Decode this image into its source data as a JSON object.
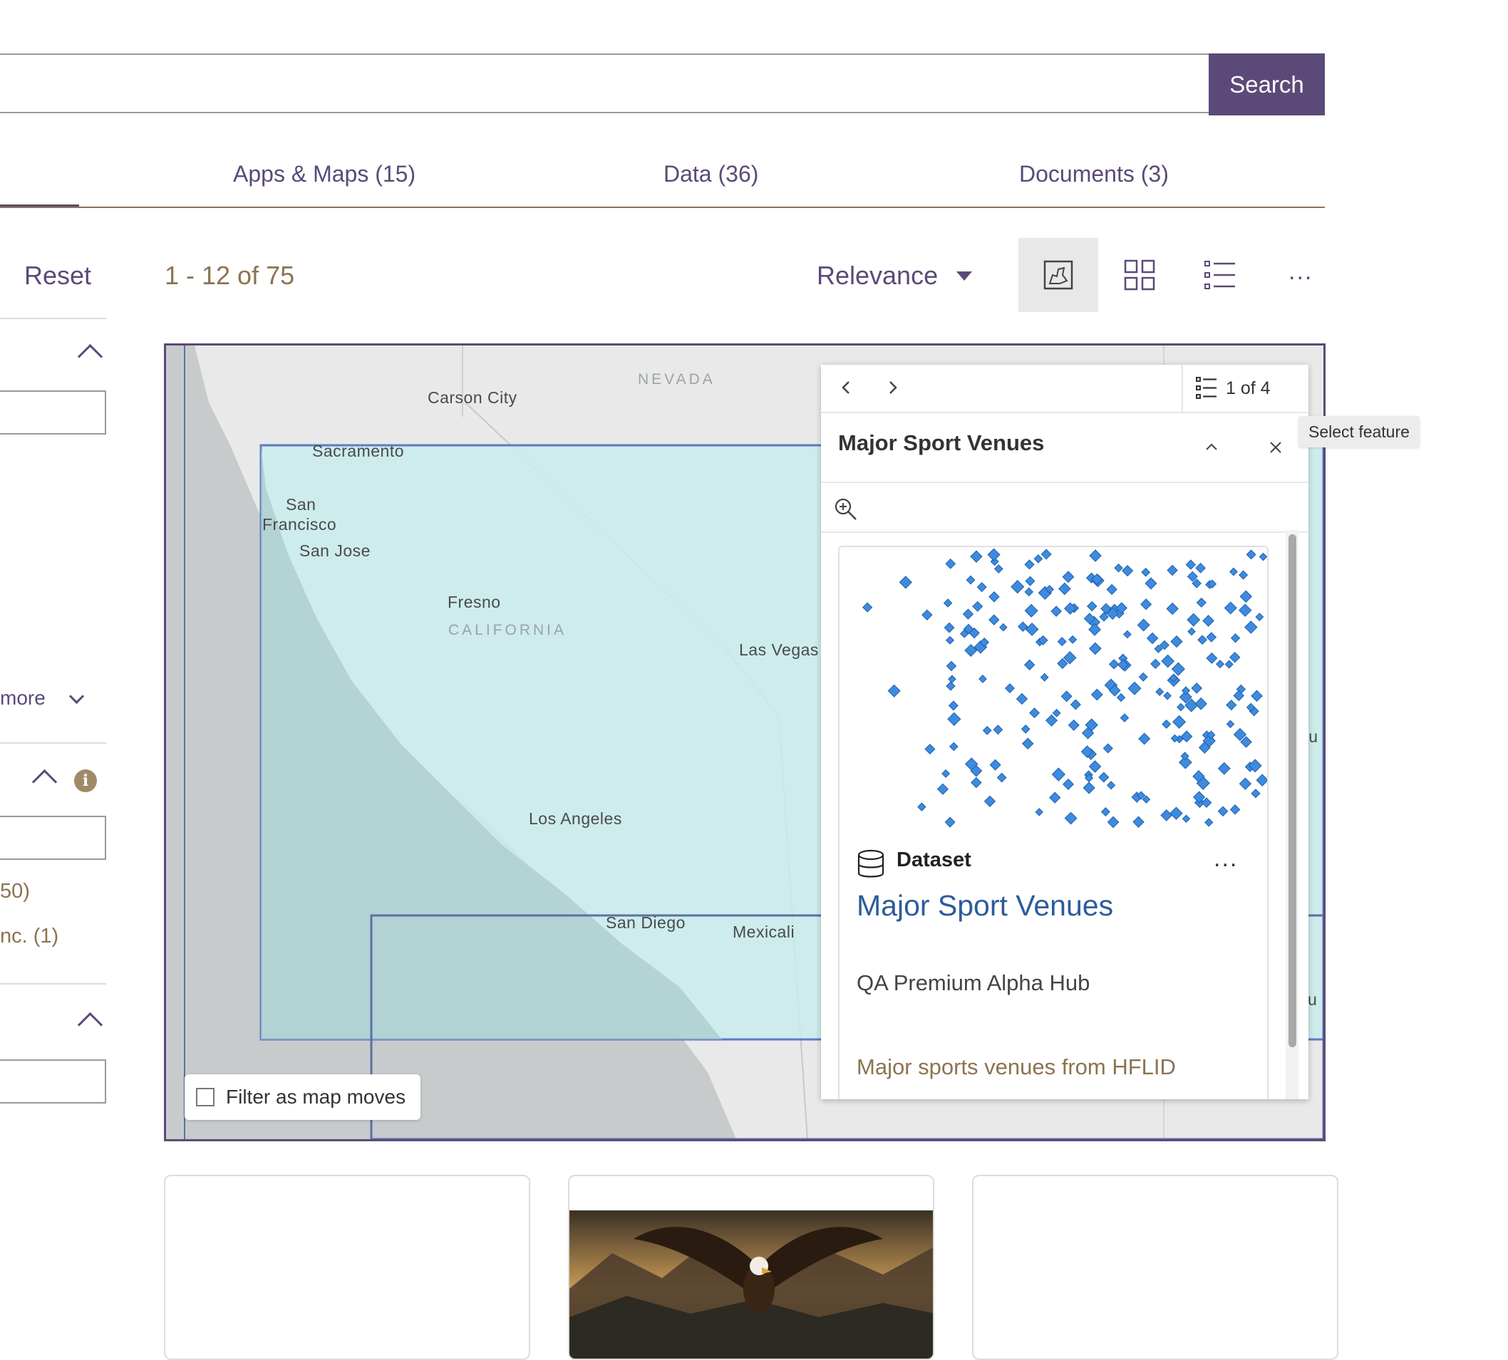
{
  "search": {
    "button_label": "Search",
    "placeholder": ""
  },
  "tabs": [
    {
      "label": "Apps & Maps (15)"
    },
    {
      "label": "Data (36)"
    },
    {
      "label": "Documents (3)"
    }
  ],
  "toolbar": {
    "reset_label": "Reset",
    "result_count": "1 - 12 of 75",
    "sort_label": "Relevance",
    "more_label": "..."
  },
  "sidebar": {
    "more_label": "more",
    "count_item_1": "50)",
    "count_item_2": "nc. (1)"
  },
  "map": {
    "labels": {
      "carson_city": "Carson City",
      "nevada": "NEVADA",
      "sacramento": "Sacramento",
      "san": "San",
      "francisco": "Francisco",
      "san_jose": "San Jose",
      "fresno": "Fresno",
      "california": "CALIFORNIA",
      "las_vegas": "Las Vegas",
      "los_angeles": "Los Angeles",
      "san_diego": "San Diego",
      "mexicali": "Mexicali",
      "edge_1": "qu",
      "edge_2": "Ju"
    },
    "filter_label": "Filter as map moves"
  },
  "popup": {
    "counter": "1 of 4",
    "title": "Major Sport Venues",
    "card": {
      "type": "Dataset",
      "title": "Major Sport Venues",
      "owner": "QA Premium Alpha Hub",
      "description": "Major sports venues from HFLID",
      "more_label": "..."
    }
  },
  "tooltip": {
    "text": "Select feature"
  },
  "colors": {
    "brand": "#5b4a78",
    "accent_text": "#8c7350",
    "link": "#2b5c9b",
    "extent_fill": "#c9ecec",
    "point": "#3d8be0"
  }
}
